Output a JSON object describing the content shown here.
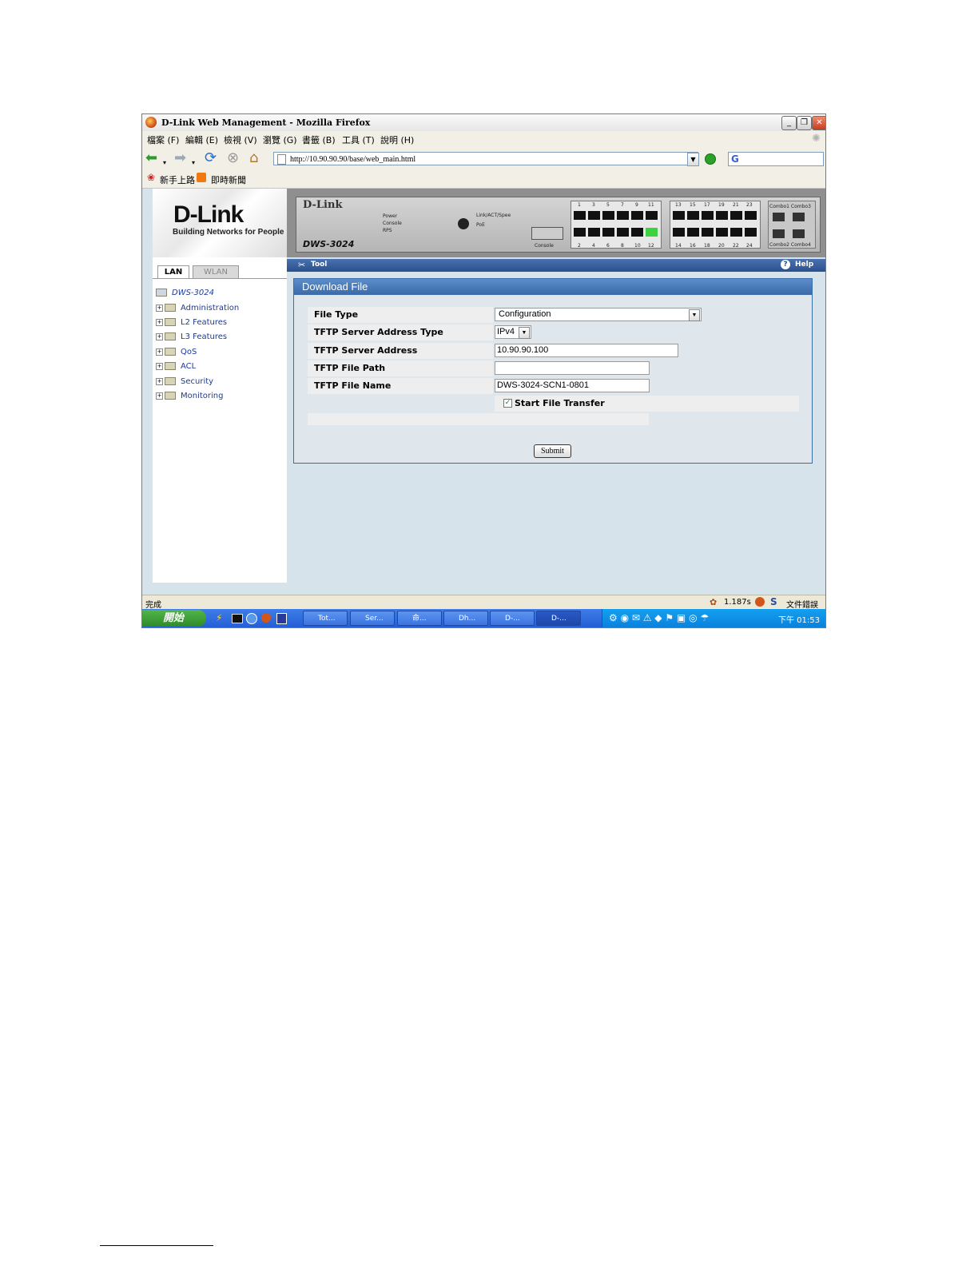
{
  "window": {
    "title": "D-Link Web Management - Mozilla Firefox",
    "buttons": [
      "_",
      "❐",
      "✕"
    ]
  },
  "menubar": {
    "items": [
      "檔案 (F)",
      "編輯 (E)",
      "檢視 (V)",
      "瀏覽 (G)",
      "書籤 (B)",
      "工具 (T)",
      "說明 (H)"
    ]
  },
  "navbar": {
    "url": "http://10.90.90.90/base/web_main.html",
    "search_value": "G"
  },
  "bookmarks": [
    "新手上路",
    "即時新聞"
  ],
  "sidebar": {
    "logo_text": "D-Link",
    "logo_tagline": "Building Networks for People",
    "tabs": [
      "LAN",
      "WLAN"
    ],
    "root": "DWS-3024",
    "items": [
      "Administration",
      "L2 Features",
      "L3 Features",
      "QoS",
      "ACL",
      "Security",
      "Monitoring"
    ]
  },
  "device": {
    "brand": "D-Link",
    "model": "DWS-3024",
    "leds": [
      "Power",
      "Console",
      "RPS"
    ],
    "leds2": [
      "Link/ACT/Spee",
      "PoE"
    ],
    "console_label": "Console",
    "top_numbers_a": [
      "1",
      "3",
      "5",
      "7",
      "9",
      "11"
    ],
    "top_numbers_b": [
      "13",
      "15",
      "17",
      "19",
      "21",
      "23"
    ],
    "bottom_numbers_a": [
      "2",
      "4",
      "6",
      "8",
      "10",
      "12"
    ],
    "bottom_numbers_b": [
      "14",
      "16",
      "18",
      "20",
      "22",
      "24"
    ],
    "combo_top": "Combo1 Combo3",
    "combo_bottom": "Combo2 Combo4"
  },
  "toolbar": {
    "tool_label": "Tool",
    "help_label": "Help"
  },
  "form": {
    "title": "Download File",
    "file_type_label": "File Type",
    "file_type_value": "Configuration",
    "addr_type_label": "TFTP Server Address Type",
    "addr_type_value": "IPv4",
    "addr_label": "TFTP Server Address",
    "addr_value": "10.90.90.100",
    "path_label": "TFTP File Path",
    "path_value": "",
    "name_label": "TFTP File Name",
    "name_value": "DWS-3024-SCN1-0801",
    "start_label": "Start File Transfer",
    "start_checked": true,
    "submit_label": "Submit"
  },
  "statusbar": {
    "left": "完成",
    "time": "1.187s",
    "right": "文件錯誤"
  },
  "taskbar": {
    "start_label": "開始",
    "tasks": [
      "Tot...",
      "Ser...",
      "命...",
      "Dh...",
      "D-...",
      "D-..."
    ],
    "clock": "下午 01:53"
  }
}
